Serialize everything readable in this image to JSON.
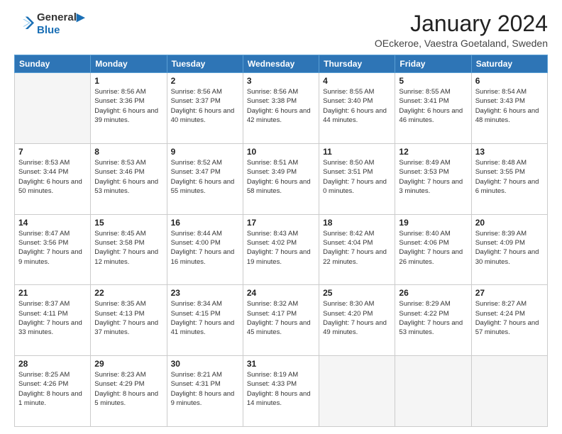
{
  "header": {
    "logo_line1": "General",
    "logo_line2": "Blue",
    "title": "January 2024",
    "subtitle": "OEckeroe, Vaestra Goetaland, Sweden"
  },
  "days_of_week": [
    "Sunday",
    "Monday",
    "Tuesday",
    "Wednesday",
    "Thursday",
    "Friday",
    "Saturday"
  ],
  "weeks": [
    [
      {
        "day": "",
        "sunrise": "",
        "sunset": "",
        "daylight": ""
      },
      {
        "day": "1",
        "sunrise": "Sunrise: 8:56 AM",
        "sunset": "Sunset: 3:36 PM",
        "daylight": "Daylight: 6 hours and 39 minutes."
      },
      {
        "day": "2",
        "sunrise": "Sunrise: 8:56 AM",
        "sunset": "Sunset: 3:37 PM",
        "daylight": "Daylight: 6 hours and 40 minutes."
      },
      {
        "day": "3",
        "sunrise": "Sunrise: 8:56 AM",
        "sunset": "Sunset: 3:38 PM",
        "daylight": "Daylight: 6 hours and 42 minutes."
      },
      {
        "day": "4",
        "sunrise": "Sunrise: 8:55 AM",
        "sunset": "Sunset: 3:40 PM",
        "daylight": "Daylight: 6 hours and 44 minutes."
      },
      {
        "day": "5",
        "sunrise": "Sunrise: 8:55 AM",
        "sunset": "Sunset: 3:41 PM",
        "daylight": "Daylight: 6 hours and 46 minutes."
      },
      {
        "day": "6",
        "sunrise": "Sunrise: 8:54 AM",
        "sunset": "Sunset: 3:43 PM",
        "daylight": "Daylight: 6 hours and 48 minutes."
      }
    ],
    [
      {
        "day": "7",
        "sunrise": "Sunrise: 8:53 AM",
        "sunset": "Sunset: 3:44 PM",
        "daylight": "Daylight: 6 hours and 50 minutes."
      },
      {
        "day": "8",
        "sunrise": "Sunrise: 8:53 AM",
        "sunset": "Sunset: 3:46 PM",
        "daylight": "Daylight: 6 hours and 53 minutes."
      },
      {
        "day": "9",
        "sunrise": "Sunrise: 8:52 AM",
        "sunset": "Sunset: 3:47 PM",
        "daylight": "Daylight: 6 hours and 55 minutes."
      },
      {
        "day": "10",
        "sunrise": "Sunrise: 8:51 AM",
        "sunset": "Sunset: 3:49 PM",
        "daylight": "Daylight: 6 hours and 58 minutes."
      },
      {
        "day": "11",
        "sunrise": "Sunrise: 8:50 AM",
        "sunset": "Sunset: 3:51 PM",
        "daylight": "Daylight: 7 hours and 0 minutes."
      },
      {
        "day": "12",
        "sunrise": "Sunrise: 8:49 AM",
        "sunset": "Sunset: 3:53 PM",
        "daylight": "Daylight: 7 hours and 3 minutes."
      },
      {
        "day": "13",
        "sunrise": "Sunrise: 8:48 AM",
        "sunset": "Sunset: 3:55 PM",
        "daylight": "Daylight: 7 hours and 6 minutes."
      }
    ],
    [
      {
        "day": "14",
        "sunrise": "Sunrise: 8:47 AM",
        "sunset": "Sunset: 3:56 PM",
        "daylight": "Daylight: 7 hours and 9 minutes."
      },
      {
        "day": "15",
        "sunrise": "Sunrise: 8:45 AM",
        "sunset": "Sunset: 3:58 PM",
        "daylight": "Daylight: 7 hours and 12 minutes."
      },
      {
        "day": "16",
        "sunrise": "Sunrise: 8:44 AM",
        "sunset": "Sunset: 4:00 PM",
        "daylight": "Daylight: 7 hours and 16 minutes."
      },
      {
        "day": "17",
        "sunrise": "Sunrise: 8:43 AM",
        "sunset": "Sunset: 4:02 PM",
        "daylight": "Daylight: 7 hours and 19 minutes."
      },
      {
        "day": "18",
        "sunrise": "Sunrise: 8:42 AM",
        "sunset": "Sunset: 4:04 PM",
        "daylight": "Daylight: 7 hours and 22 minutes."
      },
      {
        "day": "19",
        "sunrise": "Sunrise: 8:40 AM",
        "sunset": "Sunset: 4:06 PM",
        "daylight": "Daylight: 7 hours and 26 minutes."
      },
      {
        "day": "20",
        "sunrise": "Sunrise: 8:39 AM",
        "sunset": "Sunset: 4:09 PM",
        "daylight": "Daylight: 7 hours and 30 minutes."
      }
    ],
    [
      {
        "day": "21",
        "sunrise": "Sunrise: 8:37 AM",
        "sunset": "Sunset: 4:11 PM",
        "daylight": "Daylight: 7 hours and 33 minutes."
      },
      {
        "day": "22",
        "sunrise": "Sunrise: 8:35 AM",
        "sunset": "Sunset: 4:13 PM",
        "daylight": "Daylight: 7 hours and 37 minutes."
      },
      {
        "day": "23",
        "sunrise": "Sunrise: 8:34 AM",
        "sunset": "Sunset: 4:15 PM",
        "daylight": "Daylight: 7 hours and 41 minutes."
      },
      {
        "day": "24",
        "sunrise": "Sunrise: 8:32 AM",
        "sunset": "Sunset: 4:17 PM",
        "daylight": "Daylight: 7 hours and 45 minutes."
      },
      {
        "day": "25",
        "sunrise": "Sunrise: 8:30 AM",
        "sunset": "Sunset: 4:20 PM",
        "daylight": "Daylight: 7 hours and 49 minutes."
      },
      {
        "day": "26",
        "sunrise": "Sunrise: 8:29 AM",
        "sunset": "Sunset: 4:22 PM",
        "daylight": "Daylight: 7 hours and 53 minutes."
      },
      {
        "day": "27",
        "sunrise": "Sunrise: 8:27 AM",
        "sunset": "Sunset: 4:24 PM",
        "daylight": "Daylight: 7 hours and 57 minutes."
      }
    ],
    [
      {
        "day": "28",
        "sunrise": "Sunrise: 8:25 AM",
        "sunset": "Sunset: 4:26 PM",
        "daylight": "Daylight: 8 hours and 1 minute."
      },
      {
        "day": "29",
        "sunrise": "Sunrise: 8:23 AM",
        "sunset": "Sunset: 4:29 PM",
        "daylight": "Daylight: 8 hours and 5 minutes."
      },
      {
        "day": "30",
        "sunrise": "Sunrise: 8:21 AM",
        "sunset": "Sunset: 4:31 PM",
        "daylight": "Daylight: 8 hours and 9 minutes."
      },
      {
        "day": "31",
        "sunrise": "Sunrise: 8:19 AM",
        "sunset": "Sunset: 4:33 PM",
        "daylight": "Daylight: 8 hours and 14 minutes."
      },
      {
        "day": "",
        "sunrise": "",
        "sunset": "",
        "daylight": ""
      },
      {
        "day": "",
        "sunrise": "",
        "sunset": "",
        "daylight": ""
      },
      {
        "day": "",
        "sunrise": "",
        "sunset": "",
        "daylight": ""
      }
    ]
  ]
}
